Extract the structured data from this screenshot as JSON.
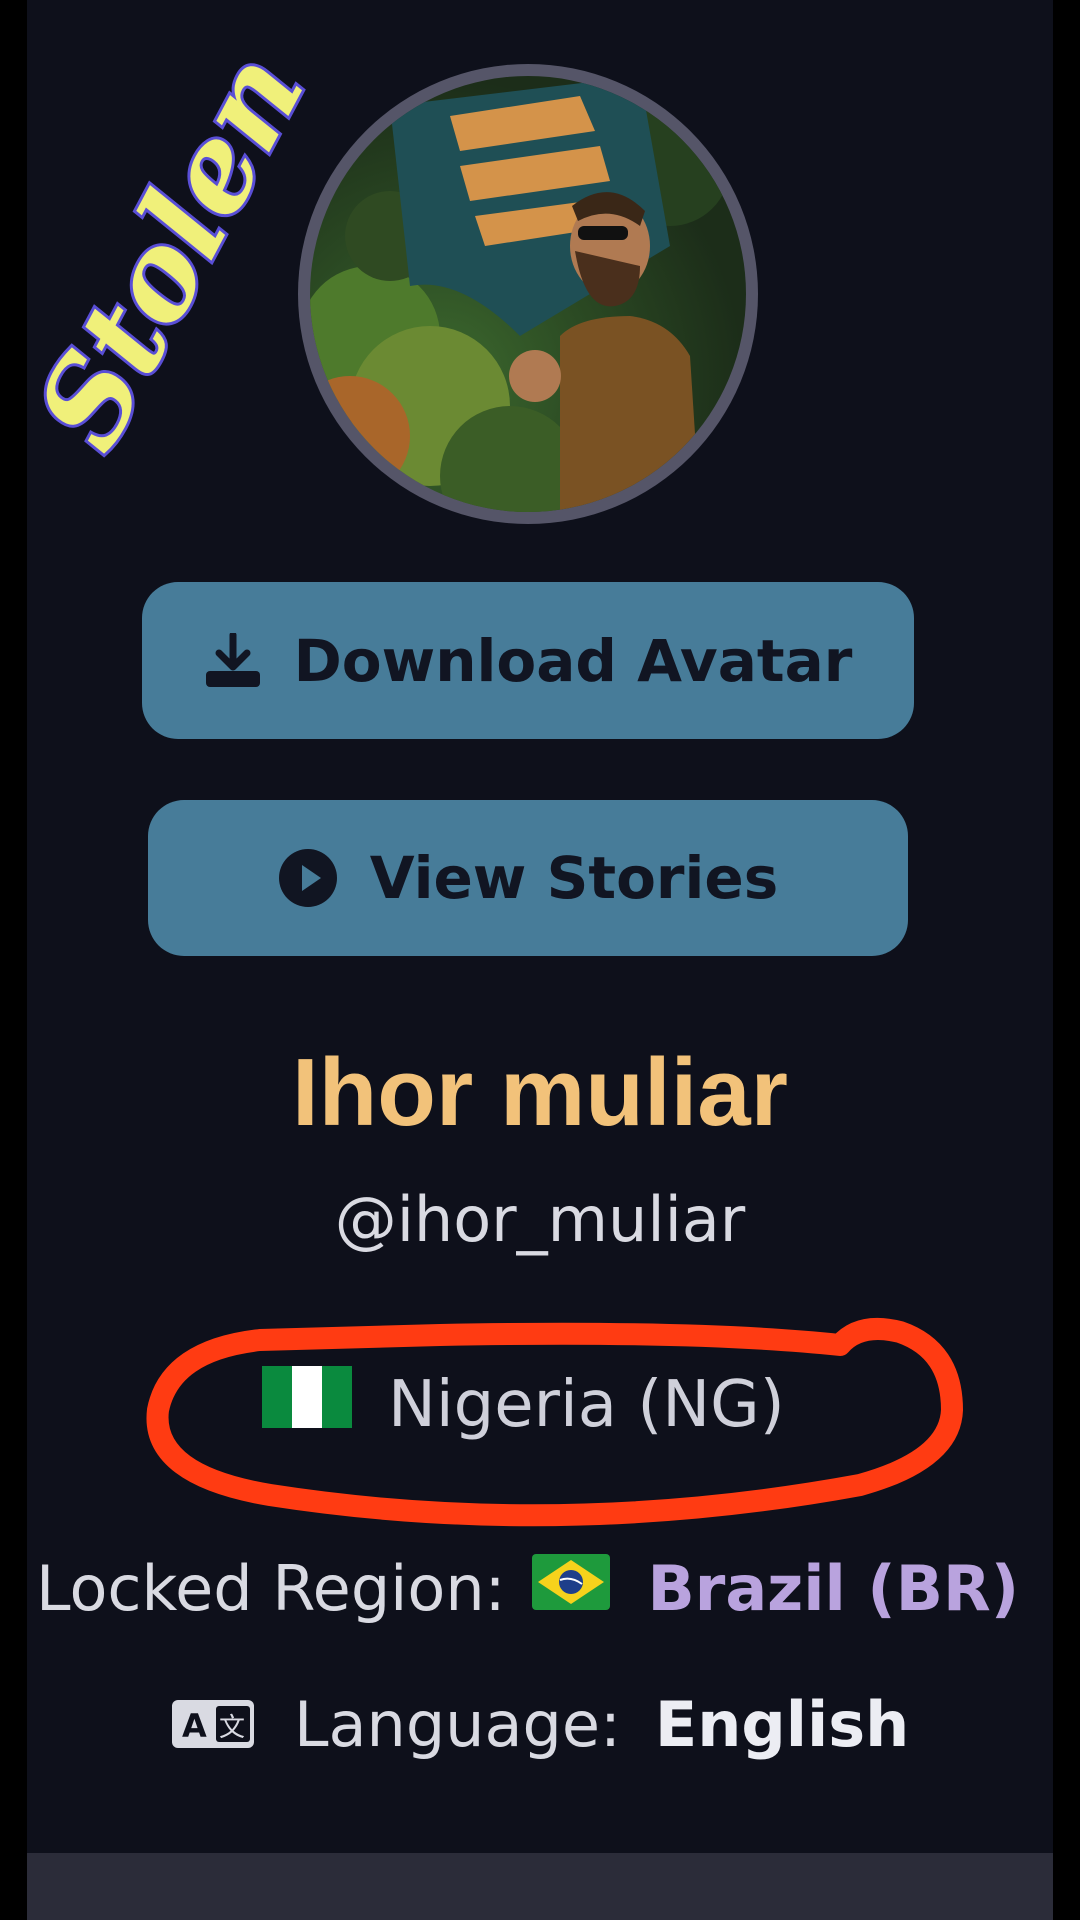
{
  "profile": {
    "display_name": "Ihor muliar",
    "username": "@ihor_muliar",
    "country": "Nigeria (NG)",
    "country_flag": "nigeria-flag",
    "locked_region_label": "Locked Region:",
    "locked_region_value": "Brazil (BR)",
    "locked_region_flag": "brazil-flag",
    "language_label": "Language:",
    "language_value": "English"
  },
  "actions": {
    "download_avatar": "Download Avatar",
    "view_stories": "View Stories"
  },
  "overlay": {
    "watermark_text": "Stolen",
    "annotation_color": "#ff3b12"
  },
  "colors": {
    "background": "#0e101b",
    "button": "#477c99",
    "name": "#f2c27a",
    "region_value": "#b9a3de"
  }
}
